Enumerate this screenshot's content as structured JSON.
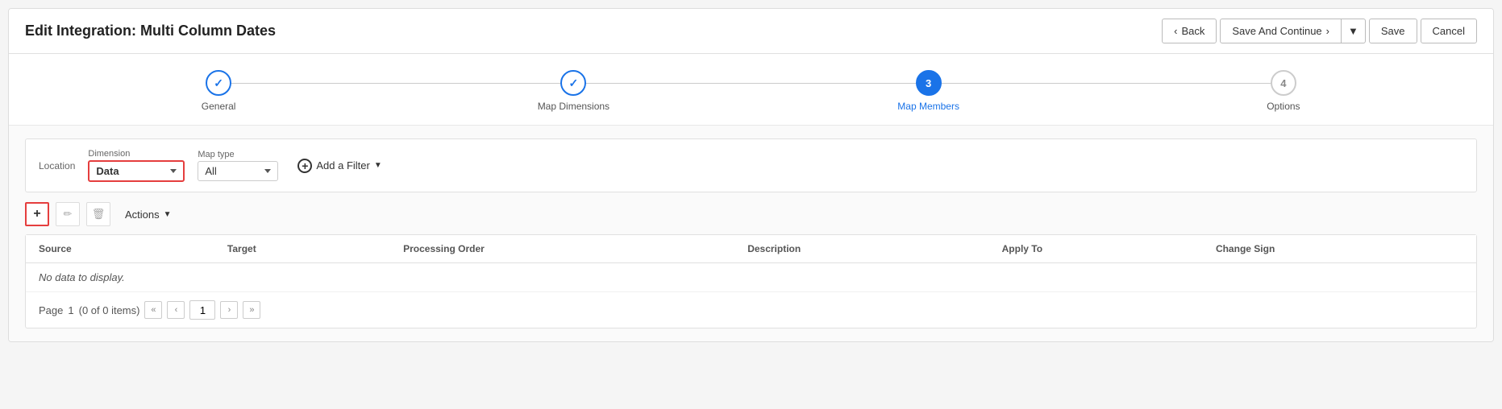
{
  "page": {
    "title": "Edit Integration: Multi Column Dates"
  },
  "header": {
    "back_label": "Back",
    "save_and_continue_label": "Save And Continue",
    "save_label": "Save",
    "cancel_label": "Cancel"
  },
  "stepper": {
    "steps": [
      {
        "id": 1,
        "label": "General",
        "state": "completed",
        "icon": "✓"
      },
      {
        "id": 2,
        "label": "Map Dimensions",
        "state": "completed",
        "icon": "✓"
      },
      {
        "id": 3,
        "label": "Map Members",
        "state": "active",
        "icon": "3"
      },
      {
        "id": 4,
        "label": "Options",
        "state": "pending",
        "icon": "4"
      }
    ]
  },
  "filters": {
    "location_label": "Location",
    "dimension_label": "Dimension",
    "dimension_value": "Data",
    "maptype_label": "Map type",
    "maptype_value": "All",
    "add_filter_label": "Add a Filter"
  },
  "toolbar": {
    "add_tooltip": "+",
    "edit_tooltip": "✏",
    "delete_tooltip": "🗑",
    "actions_label": "Actions"
  },
  "table": {
    "columns": [
      {
        "key": "source",
        "label": "Source"
      },
      {
        "key": "target",
        "label": "Target"
      },
      {
        "key": "processing_order",
        "label": "Processing Order"
      },
      {
        "key": "description",
        "label": "Description"
      },
      {
        "key": "apply_to",
        "label": "Apply To"
      },
      {
        "key": "change_sign",
        "label": "Change Sign"
      }
    ],
    "no_data_message": "No data to display.",
    "rows": []
  },
  "pagination": {
    "page_label": "Page",
    "current_page": "1",
    "items_label": "(0 of 0 items)"
  },
  "icons": {
    "chevron_left": "‹",
    "chevron_right": "›",
    "chevron_first": "«",
    "chevron_last": "»",
    "chevron_down": "▼",
    "back_arrow": "‹",
    "forward_arrow": "›",
    "pencil": "✏",
    "trash": "🗑",
    "plus": "+"
  }
}
